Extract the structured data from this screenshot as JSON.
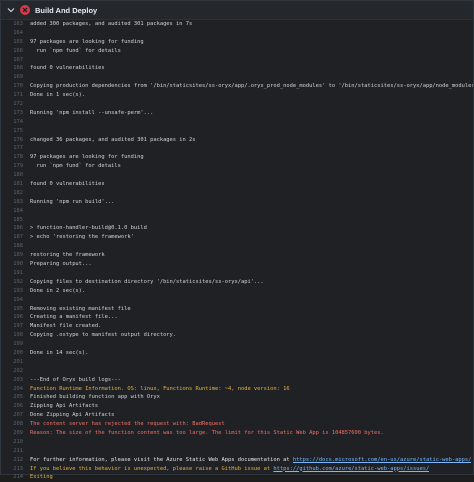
{
  "header": {
    "title": "Build And Deploy"
  },
  "colors": {
    "error": "#f47067",
    "warning": "#e3b341",
    "text": "#d0d4d9",
    "line_number": "#5c6370",
    "fail_status": "#d73a49"
  },
  "icons": {
    "collapse": "chevron-down-icon",
    "status": "failure-x-circle-icon"
  },
  "lines": [
    {
      "n": "163",
      "t": "added 300 packages, and audited 301 packages in 7s"
    },
    {
      "n": "164",
      "t": ""
    },
    {
      "n": "165",
      "t": "97 packages are looking for funding"
    },
    {
      "n": "166",
      "t": "  run `npm fund` for details"
    },
    {
      "n": "167",
      "t": ""
    },
    {
      "n": "168",
      "t": "found 0 vulnerabilities"
    },
    {
      "n": "169",
      "t": ""
    },
    {
      "n": "170",
      "t": "Copying production dependencies from '/bin/staticsites/ss-oryx/app/.oryx_prod_node_modules' to '/bin/staticsites/ss-oryx/app/node_modules'..."
    },
    {
      "n": "171",
      "t": "Done in 1 sec(s)."
    },
    {
      "n": "172",
      "t": ""
    },
    {
      "n": "173",
      "t": "Running 'npm install --unsafe-perm'..."
    },
    {
      "n": "174",
      "t": ""
    },
    {
      "n": "175",
      "t": ""
    },
    {
      "n": "176",
      "t": "changed 36 packages, and audited 301 packages in 2s"
    },
    {
      "n": "177",
      "t": ""
    },
    {
      "n": "178",
      "t": "97 packages are looking for funding"
    },
    {
      "n": "179",
      "t": "  run `npm fund` for details"
    },
    {
      "n": "180",
      "t": ""
    },
    {
      "n": "181",
      "t": "found 0 vulnerabilities"
    },
    {
      "n": "182",
      "t": ""
    },
    {
      "n": "183",
      "t": "Running 'npm run build'..."
    },
    {
      "n": "184",
      "t": ""
    },
    {
      "n": "185",
      "t": ""
    },
    {
      "n": "186",
      "t": "> function-handler-build@0.1.0 build"
    },
    {
      "n": "187",
      "t": "> echo 'restoring the framework'"
    },
    {
      "n": "188",
      "t": ""
    },
    {
      "n": "189",
      "t": "restoring the framework"
    },
    {
      "n": "190",
      "t": "Preparing output..."
    },
    {
      "n": "191",
      "t": ""
    },
    {
      "n": "192",
      "t": "Copying files to destination directory '/bin/staticsites/ss-oryx/api'..."
    },
    {
      "n": "193",
      "t": "Done in 2 sec(s)."
    },
    {
      "n": "194",
      "t": ""
    },
    {
      "n": "195",
      "t": "Removing existing manifest file"
    },
    {
      "n": "196",
      "t": "Creating a manifest file..."
    },
    {
      "n": "197",
      "t": "Manifest file created."
    },
    {
      "n": "198",
      "t": "Copying .ostype to manifest output directory."
    },
    {
      "n": "199",
      "t": ""
    },
    {
      "n": "200",
      "t": "Done in 14 sec(s)."
    },
    {
      "n": "201",
      "t": ""
    },
    {
      "n": "202",
      "t": ""
    },
    {
      "n": "203",
      "t": "---End of Oryx build logs---"
    },
    {
      "n": "204",
      "t": "Function Runtime Information. OS: linux, Functions Runtime: ~4, node version: 16",
      "k": "warn"
    },
    {
      "n": "205",
      "t": "Finished building function app with Oryx"
    },
    {
      "n": "206",
      "t": "Zipping Api Artifacts"
    },
    {
      "n": "207",
      "t": "Done Zipping Api Artifacts"
    },
    {
      "n": "208",
      "t": "The content server has rejected the request with: BadRequest",
      "k": "err"
    },
    {
      "n": "209",
      "t": "Reason: The size of the function content was too large. The limit for this Static Web App is 104857600 bytes.",
      "k": "err"
    },
    {
      "n": "210",
      "t": ""
    },
    {
      "n": "211",
      "t": ""
    },
    {
      "n": "212",
      "t": "For further information, please visit the Azure Static Web Apps documentation at ",
      "u": "https://docs.microsoft.com/en-us/azure/static-web-apps/",
      "k": "hl"
    },
    {
      "n": "213",
      "t": "If you believe this behavior is unexpected, please raise a GitHub issue at ",
      "u": "https://github.com/azure/static-web-apps/issues/",
      "k": "warn"
    },
    {
      "n": "214",
      "t": "Exiting",
      "k": "warn"
    }
  ]
}
